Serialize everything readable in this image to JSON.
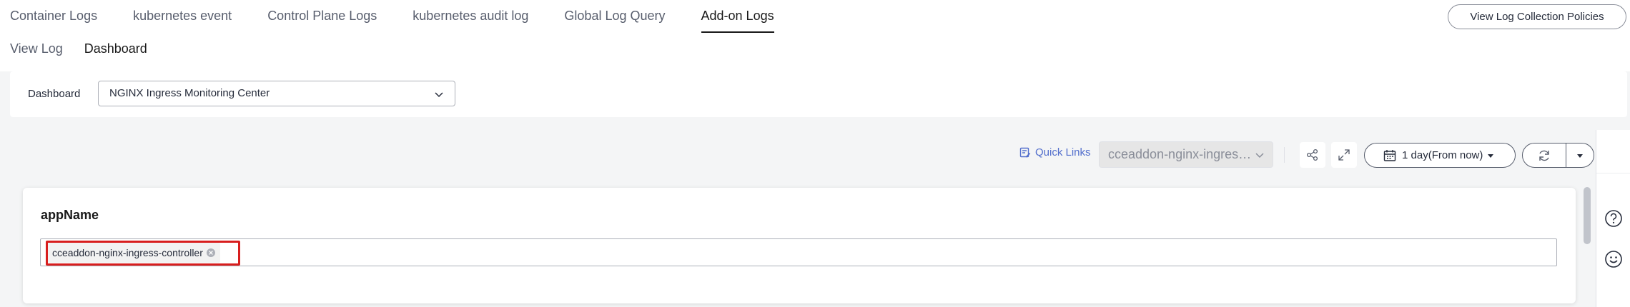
{
  "top_tabs": [
    {
      "label": "Container Logs",
      "active": false
    },
    {
      "label": "kubernetes event",
      "active": false
    },
    {
      "label": "Control Plane Logs",
      "active": false
    },
    {
      "label": "kubernetes audit log",
      "active": false
    },
    {
      "label": "Global Log Query",
      "active": false
    },
    {
      "label": "Add-on Logs",
      "active": true
    }
  ],
  "policies_button": "View Log Collection Policies",
  "sub_tabs": [
    {
      "label": "View Log",
      "active": false
    },
    {
      "label": "Dashboard",
      "active": true
    }
  ],
  "dashboard_selector": {
    "label": "Dashboard",
    "value": "NGINX Ingress Monitoring Center"
  },
  "toolbar": {
    "quick_links": "Quick Links",
    "app_select_value": "cceaddon-nginx-ingres…",
    "time_range": "1 day(From now)",
    "icons": [
      "share-icon",
      "fullscreen-icon",
      "calendar-icon",
      "refresh-icon",
      "caret-down-icon"
    ]
  },
  "card": {
    "title": "appName",
    "tags": [
      "cceaddon-nginx-ingress-controller"
    ]
  },
  "right_rail": {
    "icons": [
      "help-icon",
      "feedback-smile-icon"
    ]
  },
  "colors": {
    "link": "#526ecc",
    "highlight": "#d81e1e",
    "text": "#252b3a",
    "muted": "#8a8e99"
  }
}
